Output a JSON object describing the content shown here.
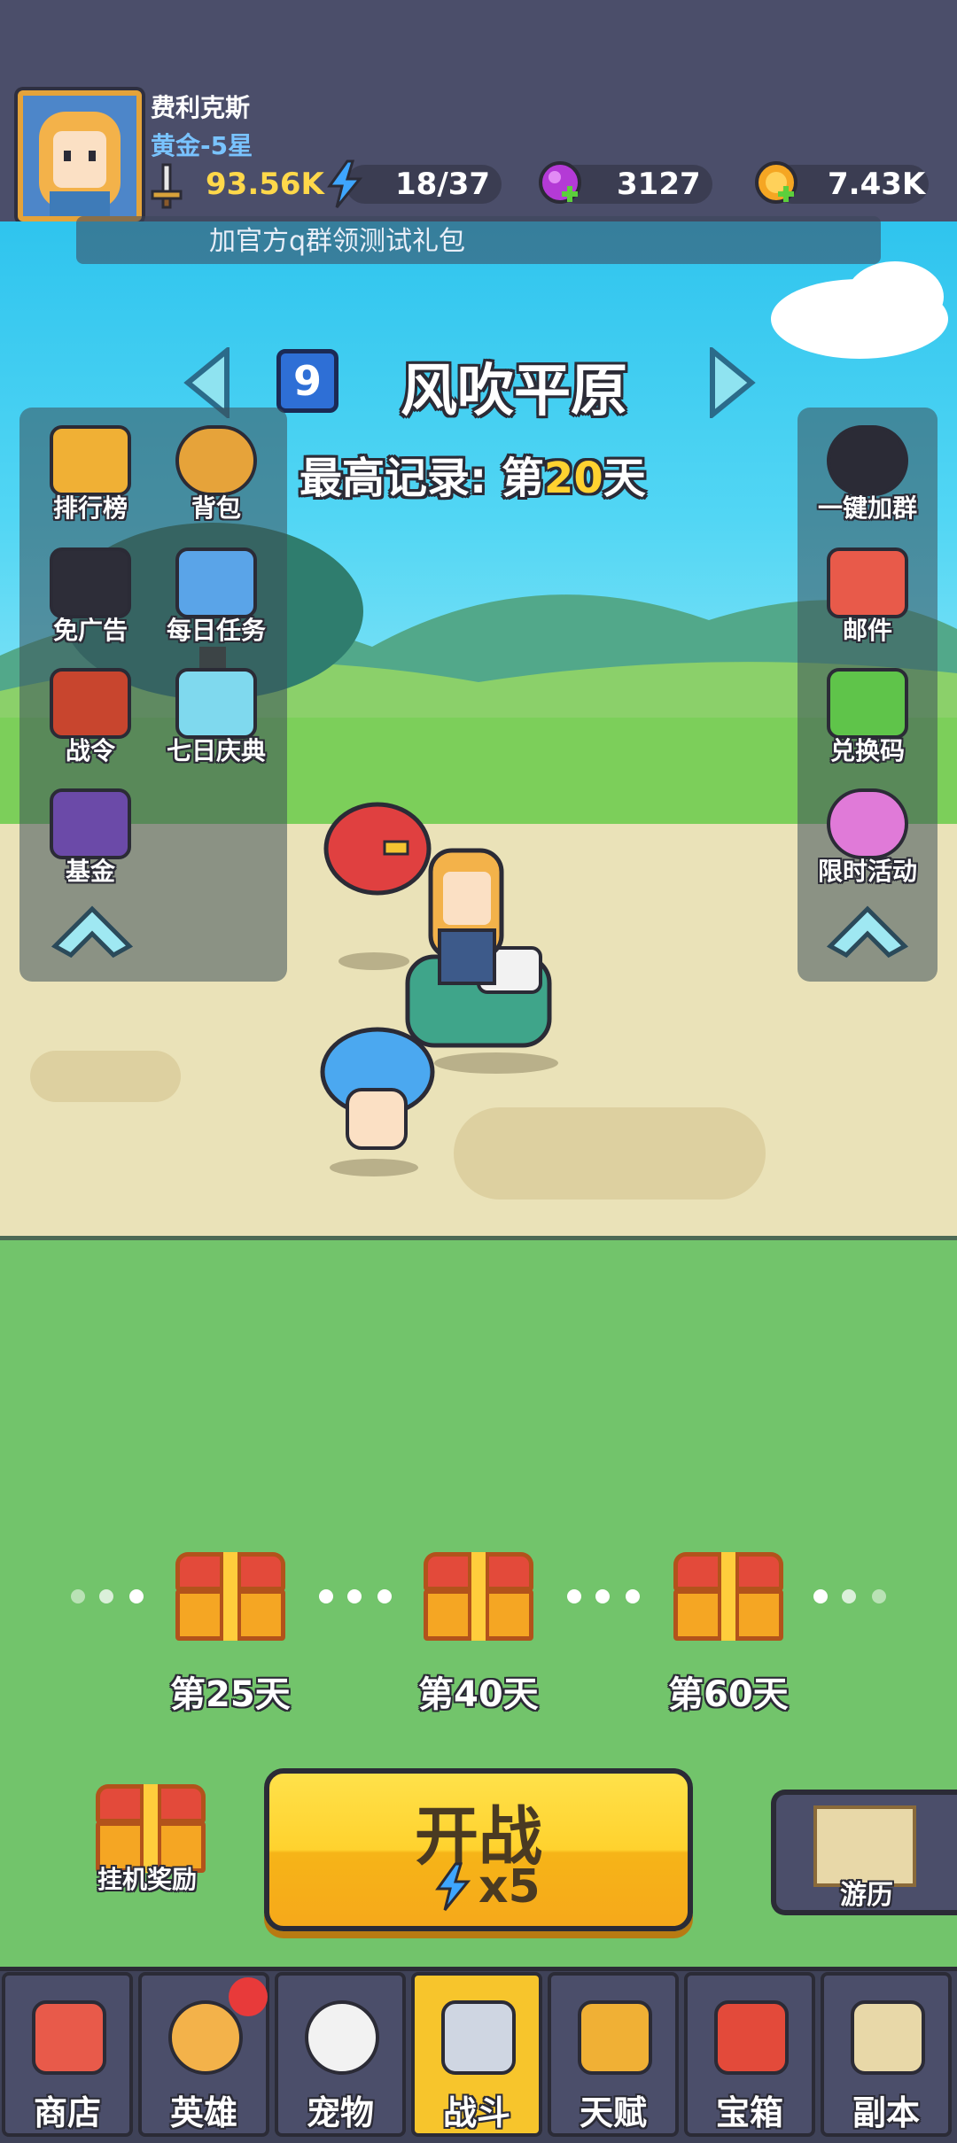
{
  "player": {
    "name": "费利克斯",
    "rank": "黄金-5星"
  },
  "resources": {
    "power": "93.56K",
    "energy": "18/37",
    "gems": "3127",
    "gold": "7.43K"
  },
  "notice": "加官方q群领测试礼包",
  "stage": {
    "number": "9",
    "name": "风吹平原",
    "record_prefix": "最高记录: 第",
    "record_day": "20",
    "record_suffix": "天"
  },
  "left_menu": [
    "排行榜",
    "背包",
    "免广告",
    "每日任务",
    "战令",
    "七日庆典",
    "基金"
  ],
  "right_menu": [
    "一键加群",
    "邮件",
    "兑换码",
    "限时活动"
  ],
  "milestones": [
    "第25天",
    "第40天",
    "第60天"
  ],
  "idle_reward_label": "挂机奖励",
  "battle_button": {
    "label": "开战",
    "cost": "x5"
  },
  "travel_label": "游历",
  "tabs": [
    "商店",
    "英雄",
    "宠物",
    "战斗",
    "天赋",
    "宝箱",
    "副本"
  ],
  "colors": {
    "accent": "#f7c52c",
    "header": "#4b4e6a",
    "sky": "#2fc4ee",
    "field": "#72c46b"
  },
  "icons": [
    "sword-icon",
    "lightning-icon",
    "gem-icon",
    "gold-coin-icon",
    "qq-penguin-icon",
    "treasure-chest-icon",
    "map-icon"
  ]
}
